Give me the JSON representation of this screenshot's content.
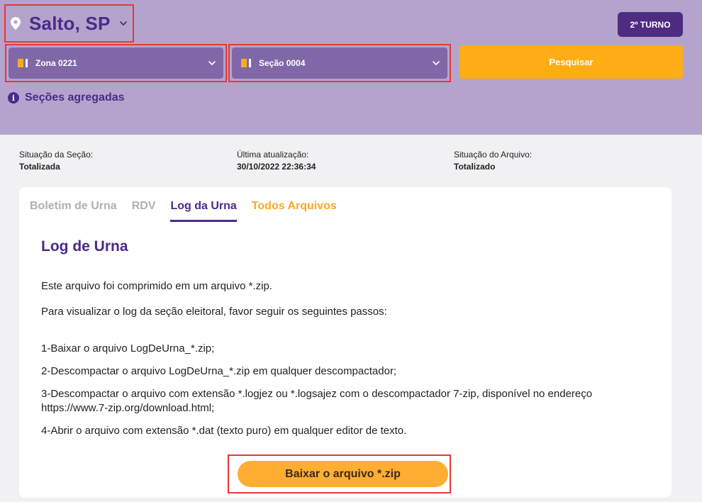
{
  "header": {
    "city": "Salto, SP",
    "turno_label": "2º TURNO",
    "zona_label": "Zona 0221",
    "secao_label": "Seção 0004",
    "search_label": "Pesquisar",
    "aggregated_label": "Seções agregadas"
  },
  "status": {
    "secao_label": "Situação da Seção:",
    "secao_value": "Totalizada",
    "update_label": "Última atualização:",
    "update_value": "30/10/2022 22:36:34",
    "arquivo_label": "Situação do Arquivo:",
    "arquivo_value": "Totalizado"
  },
  "tabs": [
    {
      "label": "Boletim de Urna"
    },
    {
      "label": "RDV"
    },
    {
      "label": "Log da Urna"
    },
    {
      "label": "Todos Arquivos"
    }
  ],
  "content": {
    "title": "Log de Urna",
    "p1": "Este arquivo foi comprimido em um arquivo *.zip.",
    "p2": "Para visualizar o log da seção eleitoral, favor seguir os seguintes passos:",
    "step1": "1-Baixar o arquivo LogDeUrna_*.zip;",
    "step2": "2-Descompactar o arquivo LogDeUrna_*.zip em qualquer descompactador;",
    "step3": "3-Descompactar o arquivo com extensão *.logjez ou *.logsajez com o descompactador 7-zip, disponível no endereço https://www.7-zip.org/download.html;",
    "step4": "4-Abrir o arquivo com extensão *.dat (texto puro) em qualquer editor de texto.",
    "download_label": "Baixar o arquivo *.zip"
  },
  "colors": {
    "purple_dark": "#4b2a8a",
    "header_bg": "#b4a4cd",
    "select_bg": "#8068a8",
    "orange": "#ffad14"
  }
}
